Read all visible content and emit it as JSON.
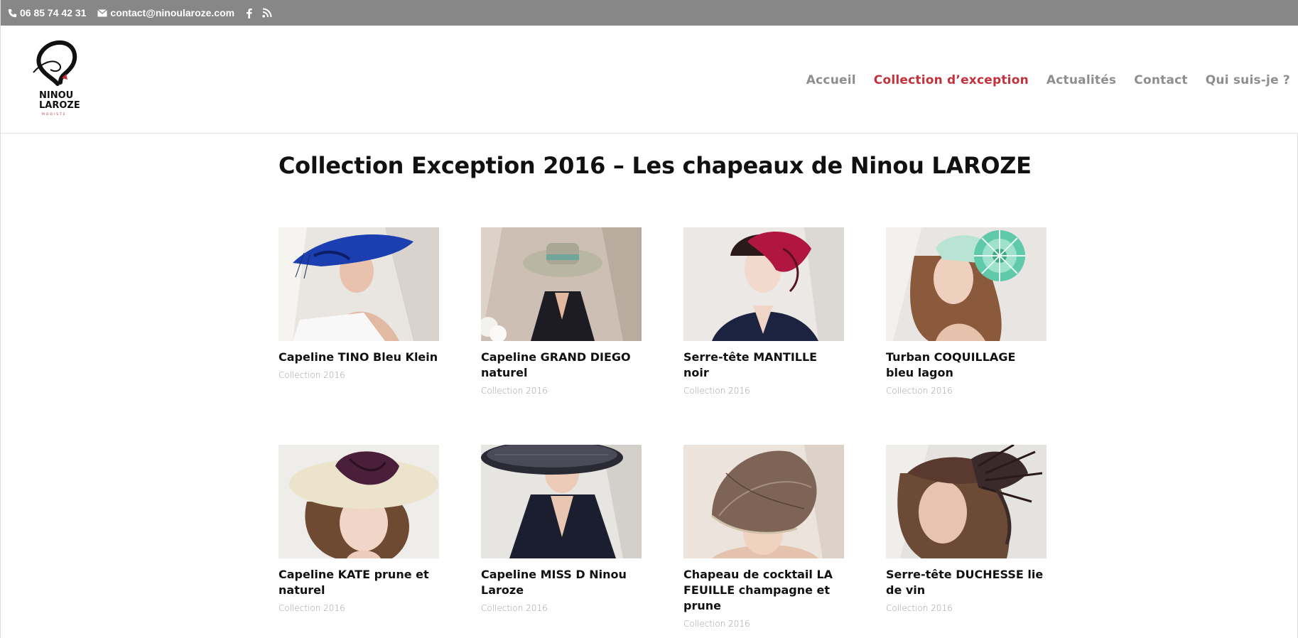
{
  "topbar": {
    "phone": "06 85 74 42 31",
    "email": "contact@ninoularoze.com",
    "social_icons": [
      "facebook-icon",
      "rss-icon"
    ],
    "background": "#878787"
  },
  "header": {
    "logo_text_line1": "NINOU",
    "logo_text_line2": "LAROZE",
    "logo_subtext": "MODISTE"
  },
  "nav": {
    "items": [
      {
        "label": "Accueil",
        "active": false
      },
      {
        "label": "Collection d’exception",
        "active": true
      },
      {
        "label": "Actualités",
        "active": false
      },
      {
        "label": "Contact",
        "active": false
      },
      {
        "label": "Qui suis-je ?",
        "active": false
      }
    ],
    "active_color": "#c3313a",
    "color": "#8e8e8e"
  },
  "page": {
    "title": "Collection Exception 2016 – Les chapeaux de Ninou LAROZE"
  },
  "products": [
    {
      "title": "Capeline TINO Bleu Klein",
      "category": "Collection 2016",
      "hat_color": "#1b3fb0"
    },
    {
      "title": "Capeline GRAND DIEGO naturel",
      "category": "Collection 2016",
      "hat_color": "#b9b7a3"
    },
    {
      "title": "Serre-tête MANTILLE noir",
      "category": "Collection 2016",
      "hat_color": "#b0163f"
    },
    {
      "title": "Turban COQUILLAGE bleu lagon",
      "category": "Collection 2016",
      "hat_color": "#5fc9a9"
    },
    {
      "title": "Capeline KATE prune et naturel",
      "category": "Collection 2016",
      "hat_color": "#4a1f3a"
    },
    {
      "title": "Capeline MISS D Ninou Laroze",
      "category": "Collection 2016",
      "hat_color": "#2a2a35"
    },
    {
      "title": "Chapeau de cocktail LA FEUILLE champagne et prune",
      "category": "Collection 2016",
      "hat_color": "#7d6457"
    },
    {
      "title": "Serre-tête DUCHESSE lie de vin",
      "category": "Collection 2016",
      "hat_color": "#3b2a2a"
    }
  ]
}
